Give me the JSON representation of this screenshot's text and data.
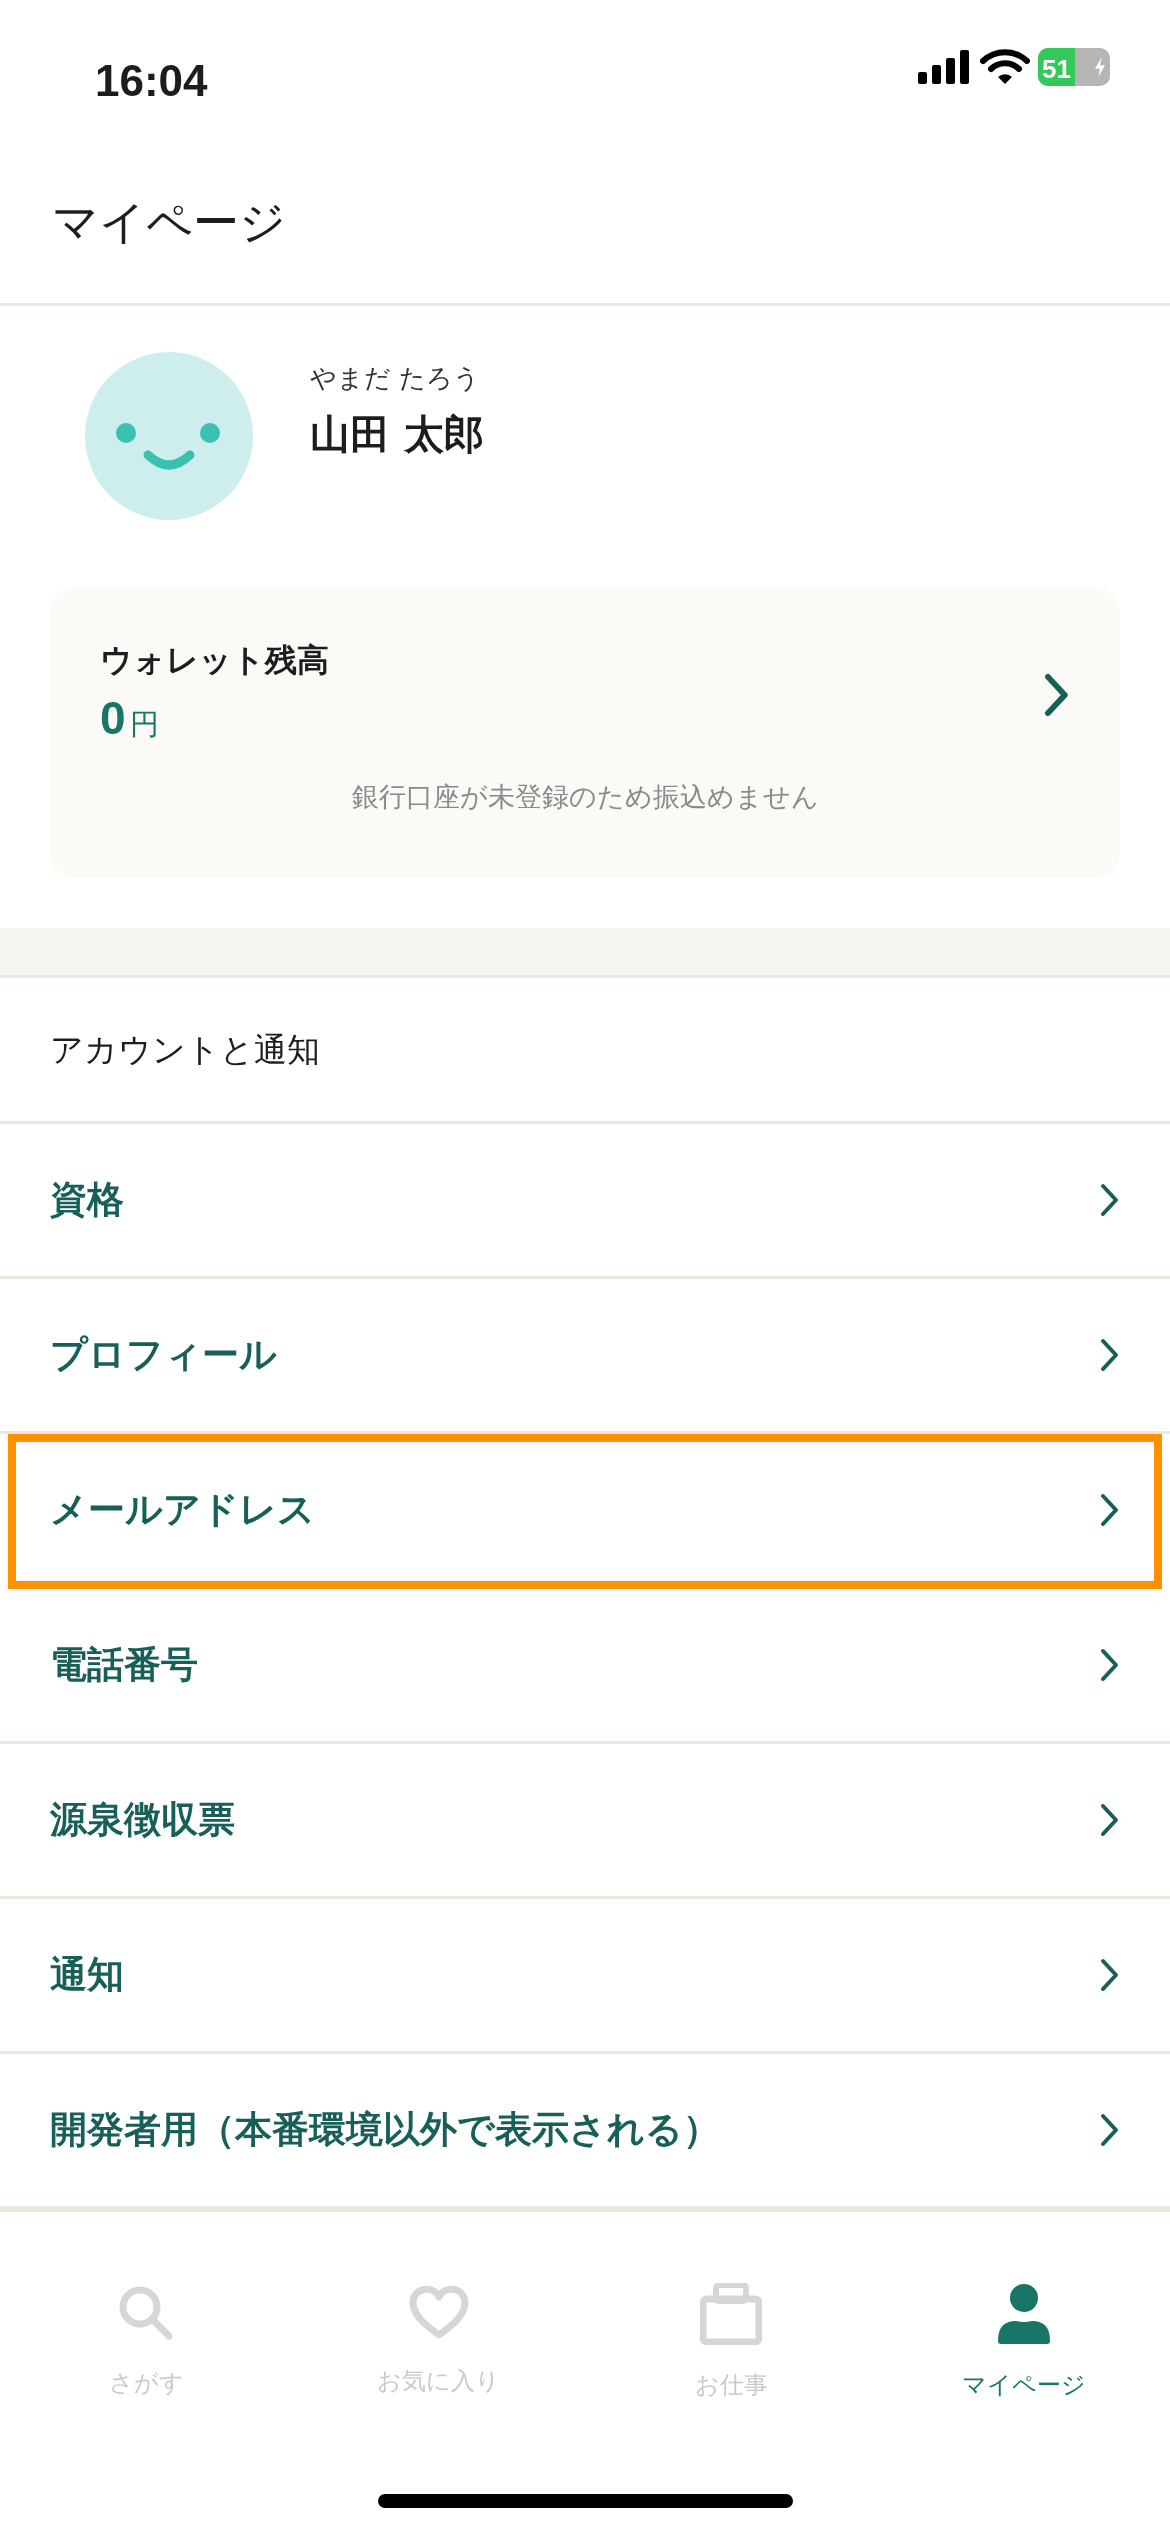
{
  "status_bar": {
    "time": "16:04",
    "battery": "51",
    "charging": true
  },
  "header": {
    "title": "マイページ"
  },
  "profile": {
    "reading": "やまだ たろう",
    "name": "山田 太郎"
  },
  "wallet": {
    "label": "ウォレット残高",
    "amount": "0",
    "unit": "円",
    "note": "銀行口座が未登録のため振込めません"
  },
  "section": {
    "title": "アカウントと通知"
  },
  "menu": [
    {
      "label": "資格",
      "highlighted": false
    },
    {
      "label": "プロフィール",
      "highlighted": false
    },
    {
      "label": "メールアドレス",
      "highlighted": true
    },
    {
      "label": "電話番号",
      "highlighted": false
    },
    {
      "label": "源泉徴収票",
      "highlighted": false
    },
    {
      "label": "通知",
      "highlighted": false
    },
    {
      "label": "開発者用（本番環境以外で表示される）",
      "highlighted": false
    }
  ],
  "tabs": [
    {
      "kind": "search",
      "label": "さがす",
      "selected": false
    },
    {
      "kind": "favorite",
      "label": "お気に入り",
      "selected": false
    },
    {
      "kind": "work",
      "label": "お仕事",
      "selected": false
    },
    {
      "kind": "mypage",
      "label": "マイページ",
      "selected": true
    }
  ]
}
